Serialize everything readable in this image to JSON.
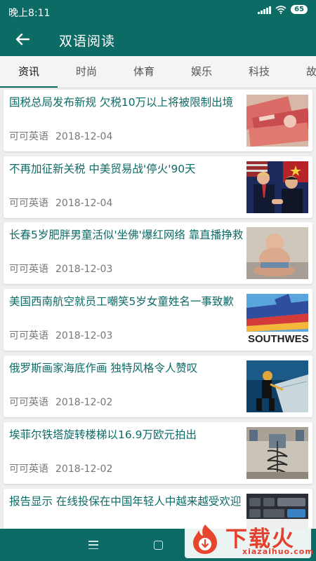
{
  "status_bar": {
    "time": "晚上8:11",
    "battery": "65"
  },
  "app_bar": {
    "title": "双语阅读",
    "back_icon": "arrow-left-icon"
  },
  "tabs": [
    {
      "label": "资讯",
      "active": true
    },
    {
      "label": "时尚",
      "active": false
    },
    {
      "label": "体育",
      "active": false
    },
    {
      "label": "娱乐",
      "active": false
    },
    {
      "label": "科技",
      "active": false
    },
    {
      "label": "故",
      "active": false
    }
  ],
  "articles": [
    {
      "title": "国税总局发布新规 欠税10万以上将被限制出境",
      "source": "可可英语",
      "date": "2018-12-04",
      "image": "money-photo"
    },
    {
      "title": "不再加征新关税 中美贸易战'停火'90天",
      "source": "可可英语",
      "date": "2018-12-04",
      "image": "leaders-handshake-photo"
    },
    {
      "title": "长春5岁肥胖男童活似'坐佛'爆红网络 靠直播挣救",
      "source": "可可英语",
      "date": "2018-12-03",
      "image": "child-sitting-photo"
    },
    {
      "title": "美国西南航空就员工嘲笑5岁女童姓名一事致歉",
      "source": "可可英语",
      "date": "2018-12-03",
      "image": "southwest-plane-photo",
      "image_text": "SOUTHWEST"
    },
    {
      "title": "俄罗斯画家海底作画 独特风格令人赞叹",
      "source": "可可英语",
      "date": "2018-12-02",
      "image": "underwater-painter-photo"
    },
    {
      "title": "埃菲尔铁塔旋转楼梯以16.9万欧元拍出",
      "source": "可可英语",
      "date": "2018-12-02",
      "image": "spiral-staircase-photo"
    },
    {
      "title": "报告显示 在线投保在中国年轻人中越来越受欢迎",
      "source": "",
      "date": "",
      "image": "keyboard-photo"
    }
  ],
  "nav_bar": {
    "menu_icon": "menu-icon",
    "home_icon": "home-icon"
  },
  "watermark": {
    "text": "下载火",
    "url": "xiazaihuo.com"
  }
}
